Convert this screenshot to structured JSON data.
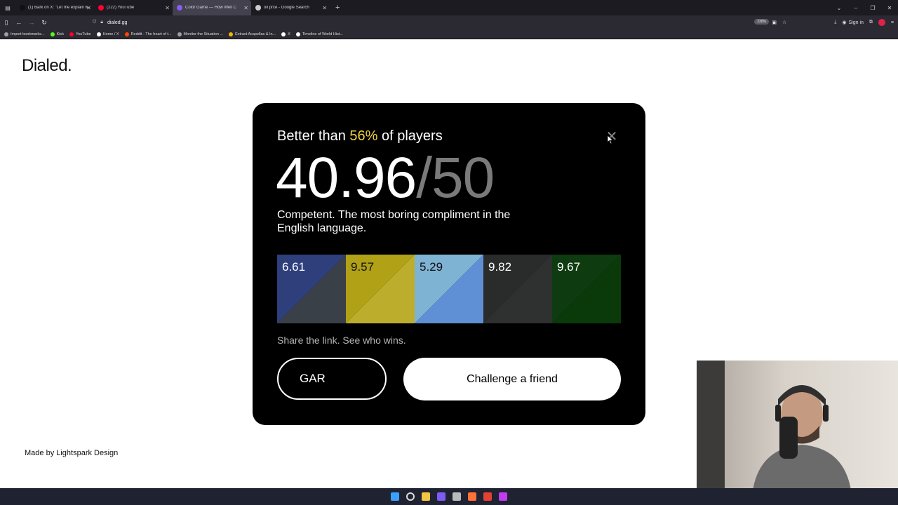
{
  "browser": {
    "tabs": [
      {
        "label": "(1) Bark on X: \"Let me explain w",
        "color": "#111111",
        "active": false
      },
      {
        "label": "(222) YouTube",
        "color": "#ff0033",
        "active": false
      },
      {
        "label": "Color Game — How Well C",
        "color": "#8a5cf6",
        "active": true
      },
      {
        "label": "oil prce - Google Search",
        "color": "#cccccc",
        "active": false
      }
    ],
    "url": "dialed.gg",
    "zoom": "230%",
    "sign_in": "Sign in",
    "bookmarks": [
      {
        "label": "Import bookmarks...",
        "color": "#9aa0a6"
      },
      {
        "label": "Kick",
        "color": "#53fc18"
      },
      {
        "label": "YouTube",
        "color": "#ff0033"
      },
      {
        "label": "Home / X",
        "color": "#ffffff"
      },
      {
        "label": "Reddit - The heart of t...",
        "color": "#ff4500"
      },
      {
        "label": "Monitor the Situation ...",
        "color": "#9aa0a6"
      },
      {
        "label": "Extract Acapellas & In...",
        "color": "#f5b400"
      },
      {
        "label": "X",
        "color": "#ffffff"
      },
      {
        "label": "Timeline of World Hist...",
        "color": "#ffffff"
      }
    ]
  },
  "page": {
    "brand": "Dialed.",
    "footer_credit": "Made by Lightspark Design"
  },
  "result": {
    "headline_prefix": "Better than ",
    "percentile": "56%",
    "headline_suffix": " of players",
    "score": "40.96",
    "out_of": "/50",
    "verdict": "Competent. The most boring compliment in the English language.",
    "swatches": [
      {
        "value": "6.61",
        "target": "#2f3f7c",
        "guess": "#3a4048",
        "text_color": "#ffffff"
      },
      {
        "value": "9.57",
        "target": "#b0a117",
        "guess": "#bdad2d",
        "text_color": "#111111"
      },
      {
        "value": "5.29",
        "target": "#7fb3d3",
        "guess": "#5f8fd5",
        "text_color": "#111111"
      },
      {
        "value": "9.82",
        "target": "#2a2b2b",
        "guess": "#2f3030",
        "text_color": "#ffffff"
      },
      {
        "value": "9.67",
        "target": "#0e3b0f",
        "guess": "#0a3a0a",
        "text_color": "#ffffff"
      }
    ],
    "share_text": "Share the link. See who wins.",
    "gar_label": "GAR",
    "challenge_label": "Challenge a friend"
  },
  "taskbar": {
    "icons": [
      {
        "name": "windows-start-icon",
        "color": "#3aa0ff"
      },
      {
        "name": "search-icon",
        "color": "#dddddd"
      },
      {
        "name": "file-explorer-icon",
        "color": "#f4c542"
      },
      {
        "name": "discord-icon",
        "color": "#7d5cf5"
      },
      {
        "name": "settings-icon",
        "color": "#bbbbbb"
      },
      {
        "name": "firefox-icon",
        "color": "#ff7139"
      },
      {
        "name": "chrome-icon",
        "color": "#e34133"
      },
      {
        "name": "obs-icon",
        "color": "#c13cf0"
      }
    ]
  }
}
